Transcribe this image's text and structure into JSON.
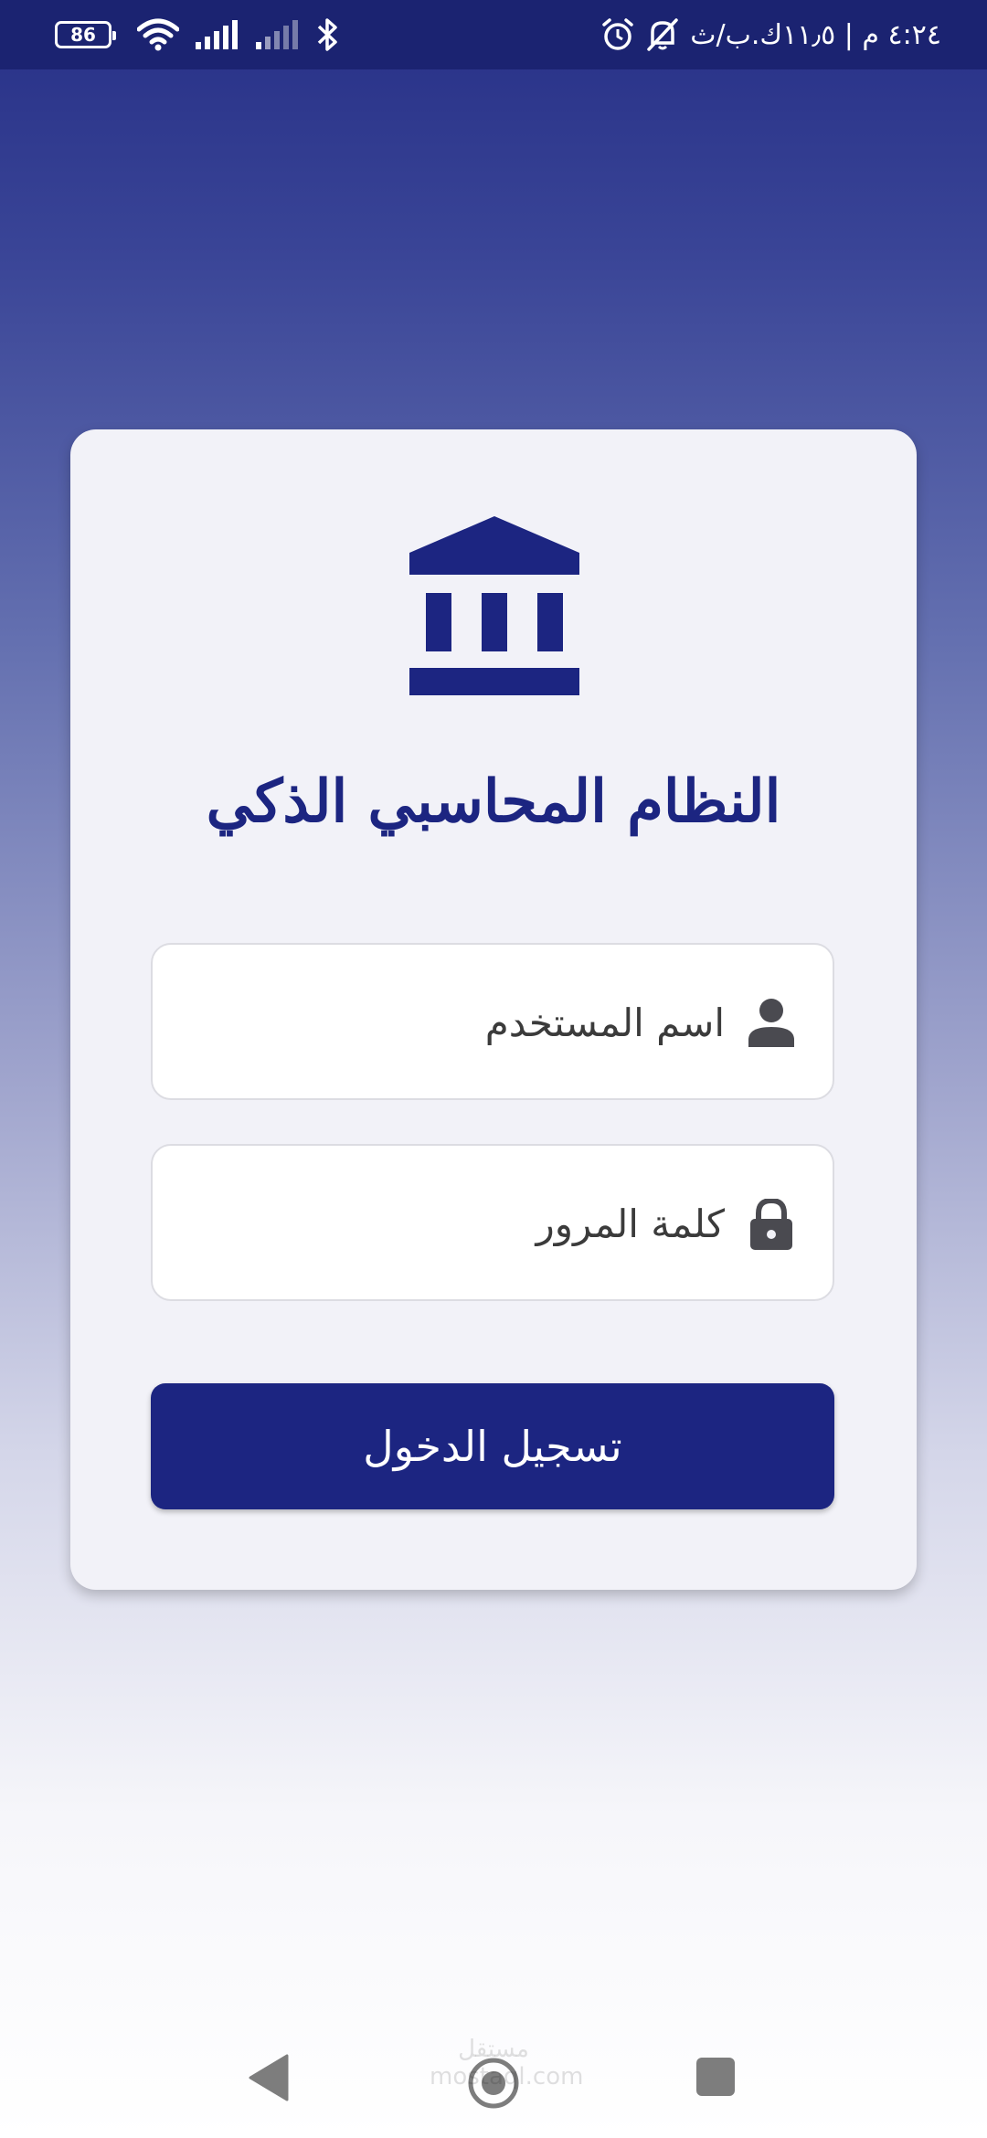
{
  "status_bar": {
    "battery_level": "86",
    "time_text": "٤:٢٤ م | ١١٫٥ك.ب/ث"
  },
  "login": {
    "title": "النظام المحاسبي الذكي",
    "username_placeholder": "اسم المستخدم",
    "password_placeholder": "كلمة المرور",
    "submit_label": "تسجيل الدخول"
  },
  "watermark": {
    "text": "مستقل mostaql.com"
  },
  "icons": {
    "logo": "bank-icon",
    "username": "person-icon",
    "password": "lock-icon"
  },
  "colors": {
    "primary": "#1c2581",
    "status_bar": "#1b2371",
    "card_background": "#f2f2f8",
    "field_icon": "#4a4a50"
  }
}
